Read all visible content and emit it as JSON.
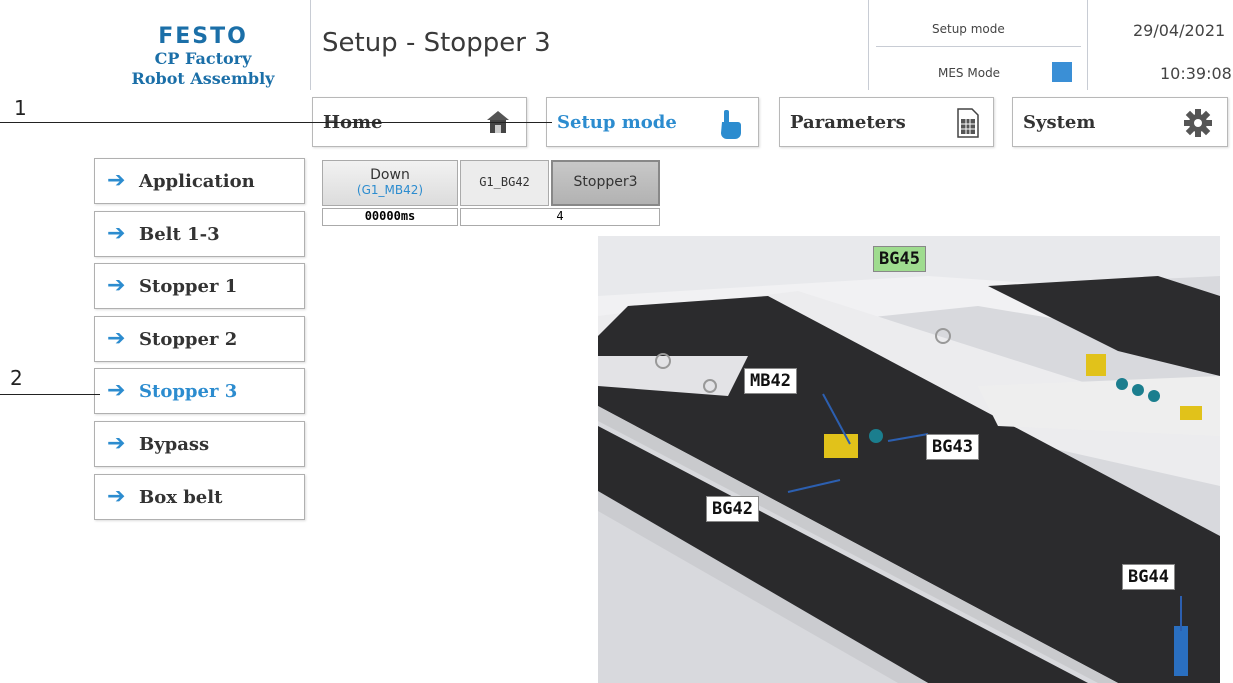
{
  "logo": {
    "brand": "FESTO",
    "line1": "CP Factory",
    "line2": "Robot Assembly"
  },
  "header": {
    "title": "Setup - Stopper 3",
    "setup_mode_label": "Setup mode",
    "mes_mode_label": "MES Mode",
    "date": "29/04/2021",
    "time": "10:39:08"
  },
  "nav": {
    "home": "Home",
    "setup_mode": "Setup mode",
    "parameters": "Parameters",
    "system": "System"
  },
  "sidebar": {
    "items": [
      {
        "label": "Application"
      },
      {
        "label": "Belt 1-3"
      },
      {
        "label": "Stopper 1"
      },
      {
        "label": "Stopper 2"
      },
      {
        "label": "Stopper 3"
      },
      {
        "label": "Bypass"
      },
      {
        "label": "Box belt"
      }
    ]
  },
  "control": {
    "down_label": "Down",
    "down_sub": "(G1_MB42)",
    "sensor": "G1_BG42",
    "stopper": "Stopper3",
    "timer": "00000ms",
    "count": "4"
  },
  "callouts": {
    "one": "1",
    "two": "2"
  },
  "image_tags": {
    "bg45": "BG45",
    "mb42": "MB42",
    "bg43": "BG43",
    "bg42": "BG42",
    "bg44": "BG44"
  },
  "colors": {
    "accent": "#2c8ccf",
    "brand": "#1b6fa8",
    "sensor_active": "#9fdc8f",
    "mes_indicator": "#3a8fd6"
  }
}
